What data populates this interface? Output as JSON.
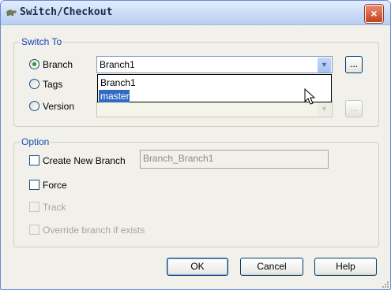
{
  "window": {
    "title": "Switch/Checkout",
    "close_glyph": "×"
  },
  "switch_to": {
    "label": "Switch To",
    "options": {
      "branch": "Branch",
      "tags": "Tags",
      "version": "Version"
    },
    "selected": "Branch",
    "branch_combo": {
      "value": "Branch1"
    },
    "dropdown_items": [
      "Branch1",
      "master"
    ],
    "hovered_item": "master",
    "browse_label": "..."
  },
  "option": {
    "label": "Option",
    "create_new_branch": {
      "label": "Create New Branch",
      "checked": false
    },
    "new_branch_name": "Branch_Branch1",
    "force": {
      "label": "Force",
      "checked": false
    },
    "track": {
      "label": "Track",
      "checked": false,
      "enabled": false
    },
    "override": {
      "label": "Override branch if exists",
      "checked": false,
      "enabled": false
    }
  },
  "buttons": {
    "ok": "OK",
    "cancel": "Cancel",
    "help": "Help"
  },
  "colors": {
    "group_label": "#1747b2",
    "selection": "#316ac5",
    "close": "#c2411d"
  }
}
